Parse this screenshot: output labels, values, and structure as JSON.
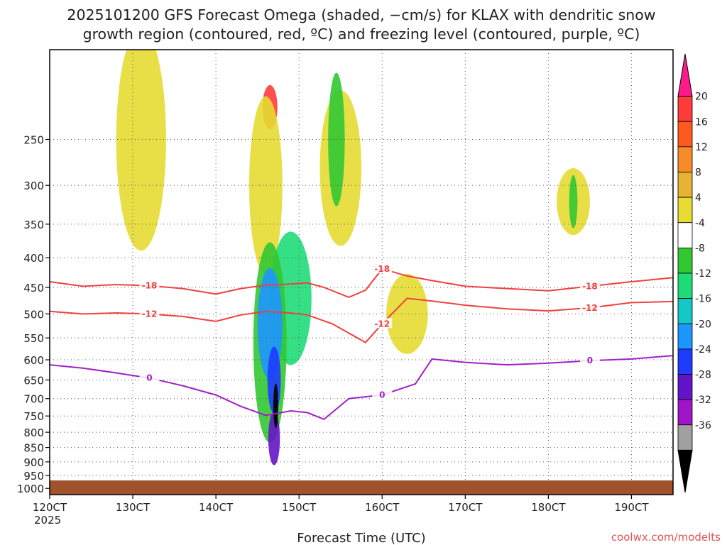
{
  "chart_data": {
    "type": "heatmap",
    "title_lines": [
      "2025101200 GFS Forecast Omega (shaded, −cm/s) for KLAX with dendritic snow",
      "growth region (contoured, red, ºC) and freezing level (contoured, purple, ºC)"
    ],
    "xlabel": "Forecast Time (UTC)",
    "credit": "coolwx.com/modelts",
    "x_ticks": [
      "120CT",
      "130CT",
      "140CT",
      "150CT",
      "160CT",
      "170CT",
      "180CT",
      "190CT"
    ],
    "x_tick_days": [
      12,
      13,
      14,
      15,
      16,
      17,
      18,
      19
    ],
    "x_year": "2025",
    "x_range_days": [
      12,
      19.5
    ],
    "y_ticks": [
      250,
      300,
      350,
      400,
      450,
      500,
      550,
      600,
      650,
      700,
      750,
      800,
      850,
      900,
      950,
      1000
    ],
    "y_range_hpa": [
      175,
      1025
    ],
    "y_scale": "log",
    "grid": true,
    "colorbar": {
      "labels": [
        "20",
        "16",
        "12",
        "8",
        "4",
        "-4",
        "-8",
        "-12",
        "-16",
        "-20",
        "-24",
        "-28",
        "-32",
        "-36"
      ],
      "colors": [
        "#ff1a8c",
        "#ff3c3c",
        "#ff5a1e",
        "#f58c28",
        "#e6b432",
        "#e6dc32",
        "#ffffff",
        "#32c832",
        "#1edc78",
        "#14c8c8",
        "#1e96ff",
        "#1e3cff",
        "#6414c8",
        "#a014c8",
        "#a0a0a0",
        "#000000"
      ]
    },
    "contours": [
      {
        "label": "-18",
        "color": "#f04040",
        "points": [
          [
            12,
            440
          ],
          [
            12.4,
            448
          ],
          [
            12.8,
            445
          ],
          [
            13.2,
            447
          ],
          [
            13.6,
            452
          ],
          [
            14,
            462
          ],
          [
            14.3,
            452
          ],
          [
            14.6,
            446
          ],
          [
            14.9,
            444
          ],
          [
            15.1,
            442
          ],
          [
            15.3,
            450
          ],
          [
            15.6,
            468
          ],
          [
            15.8,
            455
          ],
          [
            16,
            418
          ],
          [
            16.3,
            430
          ],
          [
            16.6,
            438
          ],
          [
            17,
            448
          ],
          [
            17.5,
            452
          ],
          [
            18,
            456
          ],
          [
            18.5,
            448
          ],
          [
            19,
            440
          ],
          [
            19.5,
            433
          ]
        ]
      },
      {
        "label": "-12",
        "color": "#f04040",
        "points": [
          [
            12,
            495
          ],
          [
            12.4,
            500
          ],
          [
            12.8,
            498
          ],
          [
            13.2,
            500
          ],
          [
            13.6,
            505
          ],
          [
            14,
            515
          ],
          [
            14.3,
            502
          ],
          [
            14.6,
            495
          ],
          [
            14.9,
            498
          ],
          [
            15.1,
            502
          ],
          [
            15.4,
            520
          ],
          [
            15.8,
            560
          ],
          [
            16,
            520
          ],
          [
            16.3,
            470
          ],
          [
            16.6,
            475
          ],
          [
            17,
            483
          ],
          [
            17.5,
            490
          ],
          [
            18,
            494
          ],
          [
            18.5,
            488
          ],
          [
            19,
            478
          ],
          [
            19.5,
            476
          ]
        ]
      },
      {
        "label": "0",
        "color": "#a020c8",
        "points": [
          [
            12,
            612
          ],
          [
            12.4,
            620
          ],
          [
            12.8,
            632
          ],
          [
            13.2,
            645
          ],
          [
            13.6,
            665
          ],
          [
            14,
            690
          ],
          [
            14.3,
            722
          ],
          [
            14.6,
            748
          ],
          [
            14.9,
            735
          ],
          [
            15.1,
            740
          ],
          [
            15.3,
            760
          ],
          [
            15.6,
            700
          ],
          [
            16,
            690
          ],
          [
            16.4,
            660
          ],
          [
            16.6,
            598
          ],
          [
            17,
            606
          ],
          [
            17.5,
            612
          ],
          [
            18,
            608
          ],
          [
            18.5,
            602
          ],
          [
            19,
            598
          ],
          [
            19.5,
            590
          ]
        ]
      }
    ],
    "shaded_blobs": [
      {
        "x": 14.65,
        "p": 220,
        "w": 0.18,
        "h": 0.1,
        "color": "#ff3c3c"
      },
      {
        "x": 14.6,
        "p": 300,
        "w": 0.4,
        "h": 0.4,
        "color": "#e6dc32"
      },
      {
        "x": 13.1,
        "p": 250,
        "w": 0.6,
        "h": 0.5,
        "color": "#e6dc32"
      },
      {
        "x": 15.5,
        "p": 280,
        "w": 0.5,
        "h": 0.35,
        "color": "#e6dc32"
      },
      {
        "x": 16.3,
        "p": 500,
        "w": 0.5,
        "h": 0.18,
        "color": "#e6dc32"
      },
      {
        "x": 18.3,
        "p": 320,
        "w": 0.4,
        "h": 0.15,
        "color": "#e6dc32"
      },
      {
        "x": 14.9,
        "p": 470,
        "w": 0.5,
        "h": 0.3,
        "color": "#1edc78"
      },
      {
        "x": 14.65,
        "p": 560,
        "w": 0.4,
        "h": 0.45,
        "color": "#32c832"
      },
      {
        "x": 14.65,
        "p": 520,
        "w": 0.3,
        "h": 0.25,
        "color": "#1e96ff"
      },
      {
        "x": 14.7,
        "p": 650,
        "w": 0.16,
        "h": 0.15,
        "color": "#1e3cff"
      },
      {
        "x": 14.7,
        "p": 820,
        "w": 0.14,
        "h": 0.12,
        "color": "#6414c8"
      },
      {
        "x": 14.72,
        "p": 720,
        "w": 0.06,
        "h": 0.1,
        "color": "#000000"
      },
      {
        "x": 15.45,
        "p": 250,
        "w": 0.2,
        "h": 0.3,
        "color": "#32c832"
      },
      {
        "x": 18.3,
        "p": 320,
        "w": 0.1,
        "h": 0.12,
        "color": "#32c832"
      }
    ]
  }
}
